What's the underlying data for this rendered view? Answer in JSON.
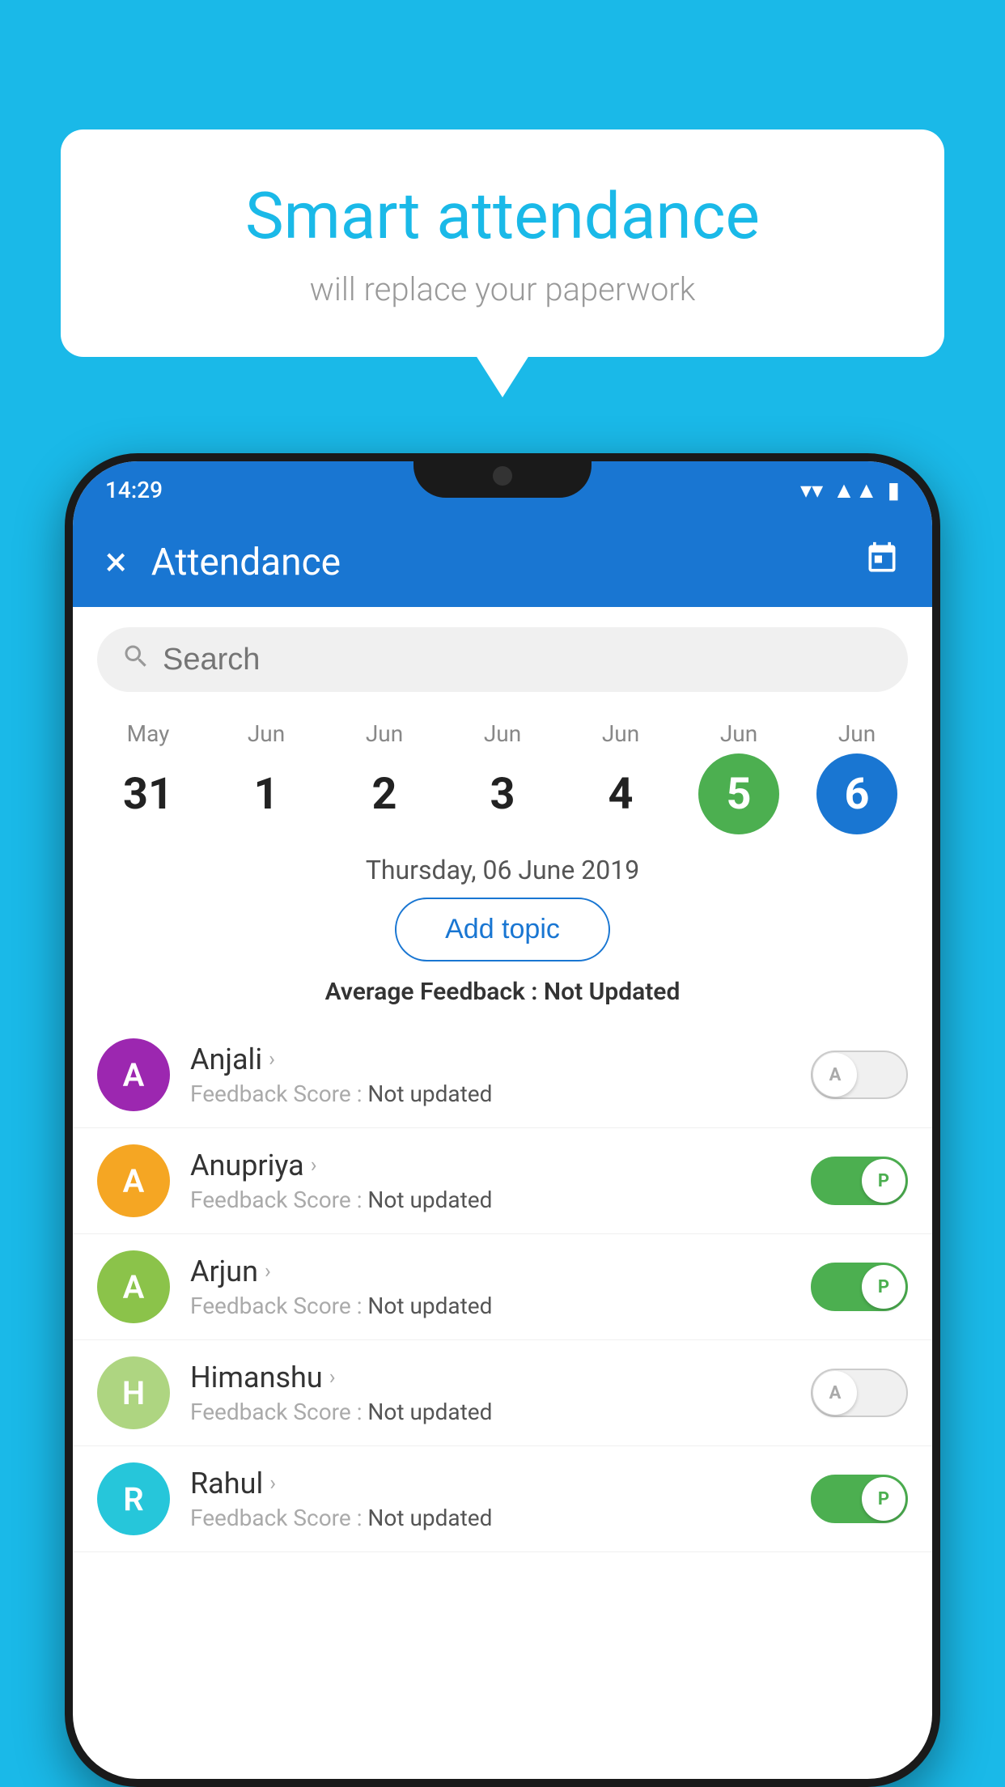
{
  "background_color": "#1ab9e8",
  "speech_bubble": {
    "title": "Smart attendance",
    "subtitle": "will replace your paperwork"
  },
  "status_bar": {
    "time": "14:29",
    "wifi": "▼",
    "signal": "▲",
    "battery": "▮"
  },
  "app_header": {
    "title": "Attendance",
    "close_label": "×",
    "calendar_icon": "📅"
  },
  "search": {
    "placeholder": "Search"
  },
  "calendar": {
    "days": [
      {
        "month": "May",
        "date": "31",
        "style": "normal"
      },
      {
        "month": "Jun",
        "date": "1",
        "style": "normal"
      },
      {
        "month": "Jun",
        "date": "2",
        "style": "normal"
      },
      {
        "month": "Jun",
        "date": "3",
        "style": "normal"
      },
      {
        "month": "Jun",
        "date": "4",
        "style": "normal"
      },
      {
        "month": "Jun",
        "date": "5",
        "style": "green"
      },
      {
        "month": "Jun",
        "date": "6",
        "style": "blue"
      }
    ]
  },
  "selected_date": "Thursday, 06 June 2019",
  "add_topic_label": "Add topic",
  "avg_feedback_label": "Average Feedback : ",
  "avg_feedback_value": "Not Updated",
  "students": [
    {
      "name": "Anjali",
      "avatar_letter": "A",
      "avatar_color": "#9c27b0",
      "feedback_label": "Feedback Score : ",
      "feedback_value": "Not updated",
      "toggle": "off",
      "toggle_letter": "A"
    },
    {
      "name": "Anupriya",
      "avatar_letter": "A",
      "avatar_color": "#f5a623",
      "feedback_label": "Feedback Score : ",
      "feedback_value": "Not updated",
      "toggle": "on",
      "toggle_letter": "P"
    },
    {
      "name": "Arjun",
      "avatar_letter": "A",
      "avatar_color": "#8bc34a",
      "feedback_label": "Feedback Score : ",
      "feedback_value": "Not updated",
      "toggle": "on",
      "toggle_letter": "P"
    },
    {
      "name": "Himanshu",
      "avatar_letter": "H",
      "avatar_color": "#aed581",
      "feedback_label": "Feedback Score : ",
      "feedback_value": "Not updated",
      "toggle": "off",
      "toggle_letter": "A"
    },
    {
      "name": "Rahul",
      "avatar_letter": "R",
      "avatar_color": "#26c6da",
      "feedback_label": "Feedback Score : ",
      "feedback_value": "Not updated",
      "toggle": "on",
      "toggle_letter": "P"
    }
  ]
}
